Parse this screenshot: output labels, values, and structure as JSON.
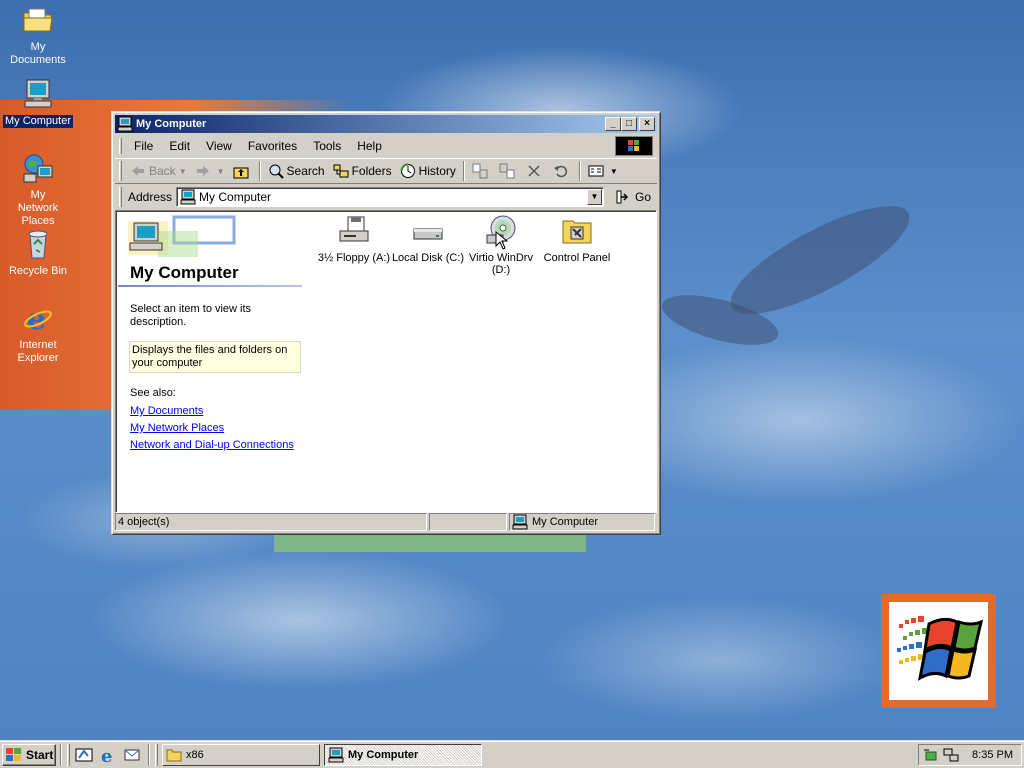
{
  "desktop": {
    "icons": [
      {
        "label": "My Documents",
        "icon": "folder-documents-icon"
      },
      {
        "label": "My Computer",
        "icon": "computer-icon"
      },
      {
        "label": "My Network Places",
        "icon": "network-places-icon"
      },
      {
        "label": "Recycle Bin",
        "icon": "recycle-bin-icon"
      },
      {
        "label": "Internet Explorer",
        "icon": "internet-explorer-icon"
      }
    ]
  },
  "window": {
    "title": "My Computer",
    "controls": {
      "minimize": "_",
      "maximize": "□",
      "close": "×"
    },
    "menu": [
      "File",
      "Edit",
      "View",
      "Favorites",
      "Tools",
      "Help"
    ],
    "toolbar": {
      "back": "Back",
      "search": "Search",
      "folders": "Folders",
      "history": "History"
    },
    "address": {
      "label": "Address",
      "value": "My Computer",
      "go": "Go"
    },
    "webview": {
      "title": "My Computer",
      "description": "Select an item to view its description.",
      "info": "Displays the files and folders on your computer",
      "see_also_label": "See also:",
      "links": [
        "My Documents",
        "My Network Places",
        "Network and Dial-up Connections"
      ]
    },
    "items": [
      {
        "label": "3½ Floppy (A:)",
        "icon": "floppy-drive-icon"
      },
      {
        "label": "Local Disk (C:)",
        "icon": "hard-disk-icon"
      },
      {
        "label": "Virtio WinDrv (D:)",
        "icon": "cd-drive-icon"
      },
      {
        "label": "Control Panel",
        "icon": "control-panel-icon"
      }
    ],
    "status": {
      "count": "4 object(s)",
      "zone": "My Computer"
    }
  },
  "taskbar": {
    "start_label": "Start",
    "tasks": [
      {
        "label": "x86",
        "active": false
      },
      {
        "label": "My Computer",
        "active": true
      }
    ],
    "clock": "8:35 PM"
  },
  "colors": {
    "title_active_start": "#0a246a",
    "title_active_end": "#a6caf0",
    "window_face": "#d4d0c8",
    "desktop_blue": "#3a6ea5",
    "link": "#0000ff"
  }
}
